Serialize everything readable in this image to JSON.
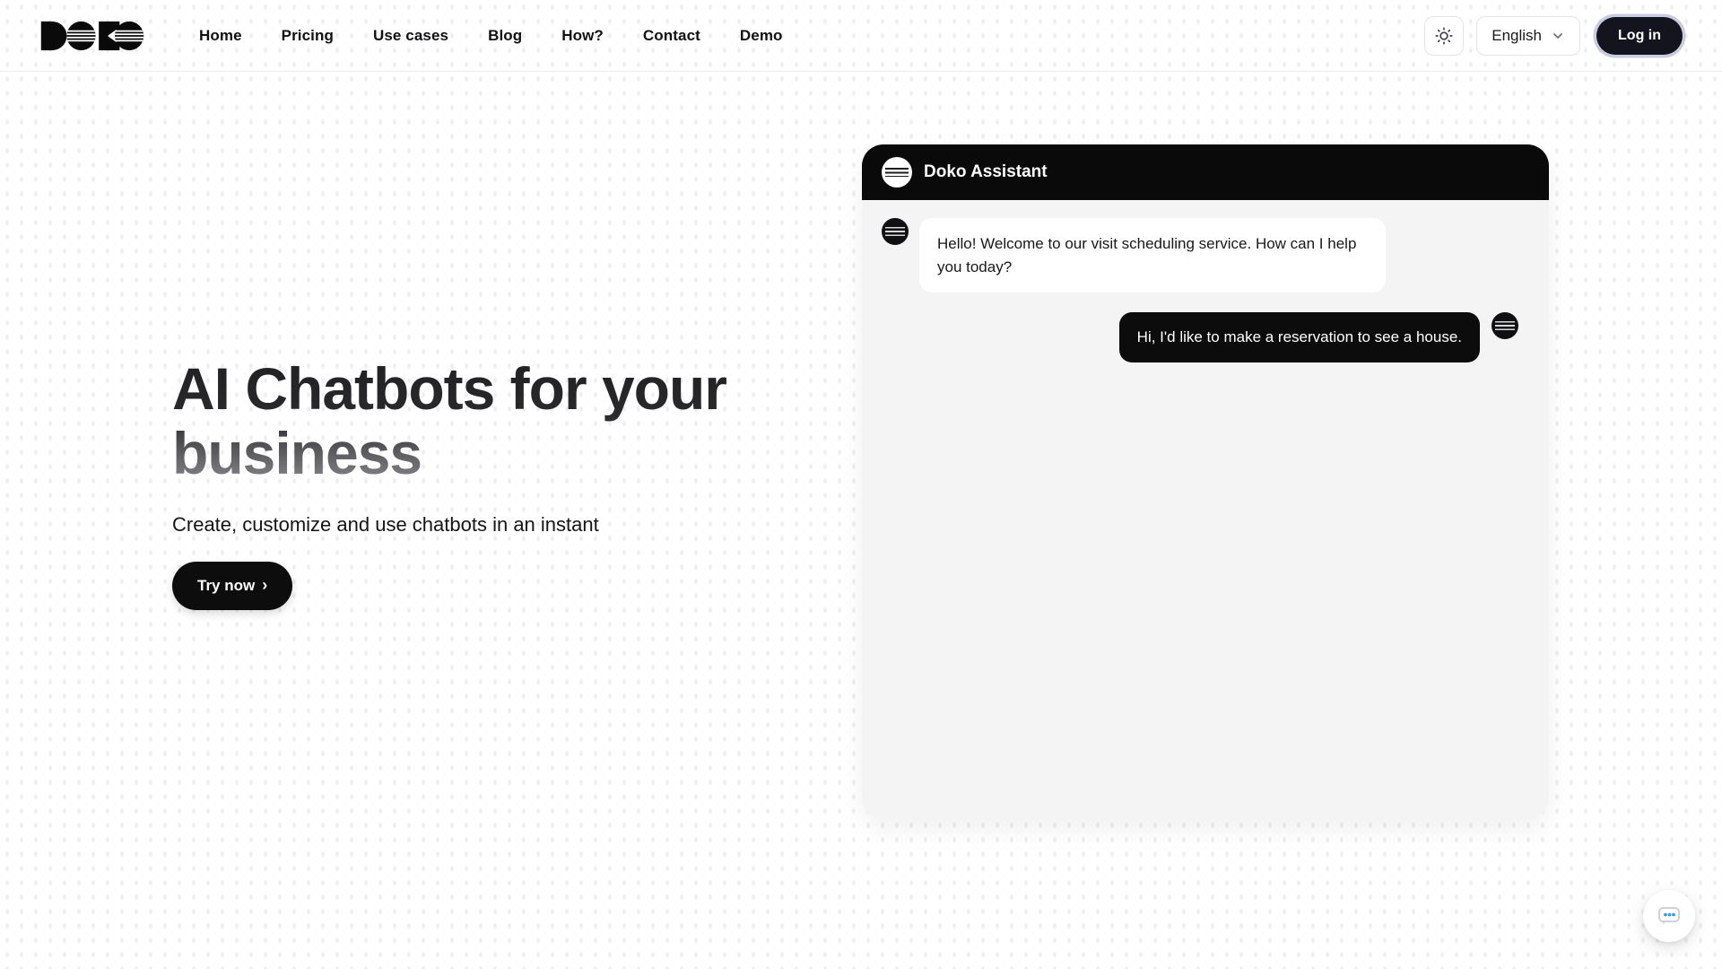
{
  "brand": {
    "name": "Doko",
    "logo_letters": "DOKO"
  },
  "nav": {
    "items": [
      "Home",
      "Pricing",
      "Use cases",
      "Blog",
      "How?",
      "Contact",
      "Demo"
    ],
    "theme_toggle_icon": "sun-icon",
    "language": {
      "selected": "English"
    },
    "login_label": "Log in"
  },
  "hero": {
    "title": "AI Chatbots for your business",
    "subtitle": "Create, customize and use chatbots in an instant",
    "cta_label": "Try now",
    "cta_chevron": "›"
  },
  "chat": {
    "title": "Doko Assistant",
    "messages": [
      {
        "role": "bot",
        "text": "Hello! Welcome to our visit scheduling service. How can I help you today?"
      },
      {
        "role": "user",
        "text": "Hi, I'd like to make a reservation to see a house."
      }
    ]
  },
  "fab": {
    "icon": "chat-bubble-icon",
    "dot_color": "#3d9be9"
  },
  "colors": {
    "header_bg": "#0a0a0b",
    "chat_body_bg": "#f4f4f5",
    "user_bubble_bg": "#0c0c0d",
    "login_btn_bg": "#14141f",
    "login_ring": "#a0a0c8",
    "hero_gradient_top": "#202023",
    "hero_gradient_bottom": "#8b8b8f"
  }
}
